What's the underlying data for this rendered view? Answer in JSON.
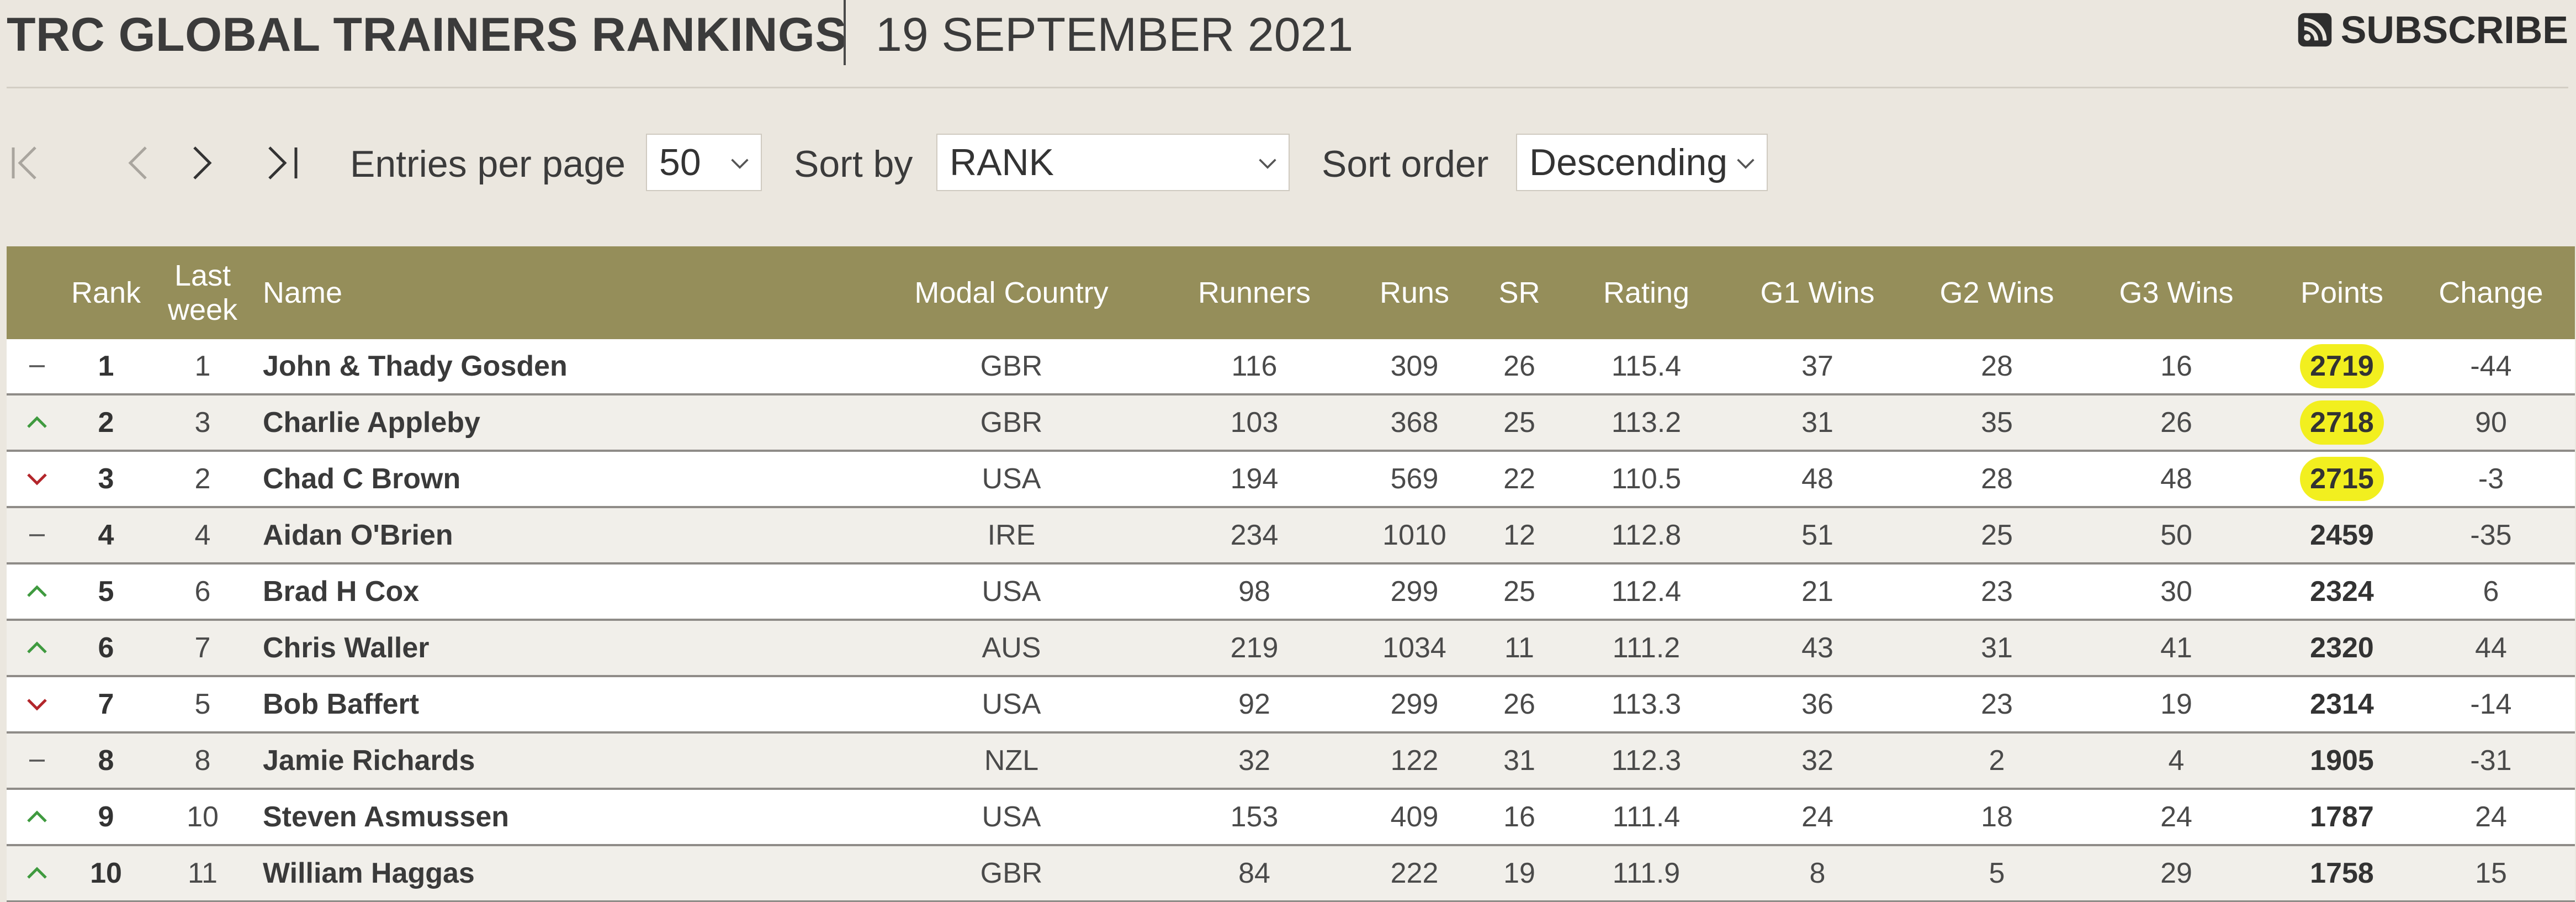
{
  "header": {
    "title": "TRC GLOBAL TRAINERS RANKINGS",
    "date": "19 SEPTEMBER 2021",
    "subscribe_label": "SUBSCRIBE",
    "subscribe_icon": "rss-icon"
  },
  "toolbar": {
    "entries_label": "Entries per page",
    "entries_value": "50",
    "sort_by_label": "Sort by",
    "sort_by_value": "RANK",
    "sort_order_label": "Sort order",
    "sort_order_value": "Descending",
    "pager_icons": [
      "first-page-icon",
      "prev-page-icon",
      "next-page-icon",
      "last-page-icon"
    ]
  },
  "table": {
    "headers": {
      "rank": "Rank",
      "last_week_line1": "Last",
      "last_week_line2": "week",
      "name": "Name",
      "country": "Modal Country",
      "runners": "Runners",
      "runs": "Runs",
      "sr": "SR",
      "rating": "Rating",
      "g1": "G1 Wins",
      "g2": "G2 Wins",
      "g3": "G3 Wins",
      "points": "Points",
      "change": "Change"
    },
    "colors": {
      "header_bg": "#958e5a",
      "up": "#3f9a3f",
      "down": "#b3262b",
      "highlight": "#f2ef1f"
    },
    "rows": [
      {
        "trend": "same",
        "rank": "1",
        "last_week": "1",
        "name": "John & Thady Gosden",
        "country": "GBR",
        "runners": "116",
        "runs": "309",
        "sr": "26",
        "rating": "115.4",
        "g1": "37",
        "g2": "28",
        "g3": "16",
        "points": "2719",
        "change": "-44",
        "highlight": true
      },
      {
        "trend": "up",
        "rank": "2",
        "last_week": "3",
        "name": "Charlie Appleby",
        "country": "GBR",
        "runners": "103",
        "runs": "368",
        "sr": "25",
        "rating": "113.2",
        "g1": "31",
        "g2": "35",
        "g3": "26",
        "points": "2718",
        "change": "90",
        "highlight": true
      },
      {
        "trend": "down",
        "rank": "3",
        "last_week": "2",
        "name": "Chad C Brown",
        "country": "USA",
        "runners": "194",
        "runs": "569",
        "sr": "22",
        "rating": "110.5",
        "g1": "48",
        "g2": "28",
        "g3": "48",
        "points": "2715",
        "change": "-3",
        "highlight": true
      },
      {
        "trend": "same",
        "rank": "4",
        "last_week": "4",
        "name": "Aidan O'Brien",
        "country": "IRE",
        "runners": "234",
        "runs": "1010",
        "sr": "12",
        "rating": "112.8",
        "g1": "51",
        "g2": "25",
        "g3": "50",
        "points": "2459",
        "change": "-35",
        "highlight": false
      },
      {
        "trend": "up",
        "rank": "5",
        "last_week": "6",
        "name": "Brad H Cox",
        "country": "USA",
        "runners": "98",
        "runs": "299",
        "sr": "25",
        "rating": "112.4",
        "g1": "21",
        "g2": "23",
        "g3": "30",
        "points": "2324",
        "change": "6",
        "highlight": false
      },
      {
        "trend": "up",
        "rank": "6",
        "last_week": "7",
        "name": "Chris Waller",
        "country": "AUS",
        "runners": "219",
        "runs": "1034",
        "sr": "11",
        "rating": "111.2",
        "g1": "43",
        "g2": "31",
        "g3": "41",
        "points": "2320",
        "change": "44",
        "highlight": false
      },
      {
        "trend": "down",
        "rank": "7",
        "last_week": "5",
        "name": "Bob Baffert",
        "country": "USA",
        "runners": "92",
        "runs": "299",
        "sr": "26",
        "rating": "113.3",
        "g1": "36",
        "g2": "23",
        "g3": "19",
        "points": "2314",
        "change": "-14",
        "highlight": false
      },
      {
        "trend": "same",
        "rank": "8",
        "last_week": "8",
        "name": "Jamie Richards",
        "country": "NZL",
        "runners": "32",
        "runs": "122",
        "sr": "31",
        "rating": "112.3",
        "g1": "32",
        "g2": "2",
        "g3": "4",
        "points": "1905",
        "change": "-31",
        "highlight": false
      },
      {
        "trend": "up",
        "rank": "9",
        "last_week": "10",
        "name": "Steven Asmussen",
        "country": "USA",
        "runners": "153",
        "runs": "409",
        "sr": "16",
        "rating": "111.4",
        "g1": "24",
        "g2": "18",
        "g3": "24",
        "points": "1787",
        "change": "24",
        "highlight": false
      },
      {
        "trend": "up",
        "rank": "10",
        "last_week": "11",
        "name": "William Haggas",
        "country": "GBR",
        "runners": "84",
        "runs": "222",
        "sr": "19",
        "rating": "111.9",
        "g1": "8",
        "g2": "5",
        "g3": "29",
        "points": "1758",
        "change": "15",
        "highlight": false
      }
    ]
  }
}
